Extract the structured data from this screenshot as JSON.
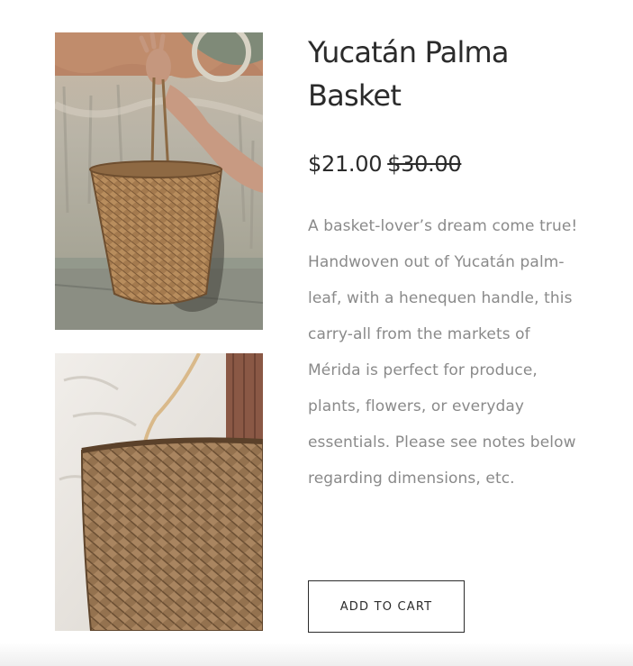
{
  "product": {
    "title": "Yucatán Palma Basket",
    "price": "$21.00",
    "compare_price": "$30.00",
    "description": "A basket-lover’s dream come true! Handwoven out of Yucatán palm-leaf, with a henequen handle, this carry-all from the markets of Mérida is perfect for produce, plants, flowers, or everyday essentials. Please see notes below regarding dimensions, etc.",
    "add_to_cart_label": "ADD TO CART"
  },
  "colors": {
    "text": "#2b2b2b",
    "description": "#8a8a8a",
    "background": "#ffffff"
  }
}
